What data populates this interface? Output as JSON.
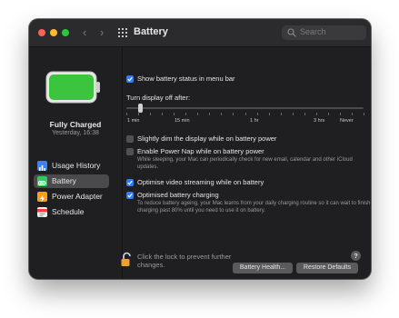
{
  "window": {
    "title": "Battery",
    "search_placeholder": "Search",
    "nav_back_glyph": "‹",
    "nav_forward_glyph": "›"
  },
  "colors": {
    "close": "#fe5f57",
    "minimize": "#febc2e",
    "zoom": "#28c840",
    "accent": "#2f7bf5",
    "battery_green": "#3cc43e"
  },
  "sidebar": {
    "battery_level_percent": 100,
    "status_title": "Fully Charged",
    "status_subtitle": "Yesterday, 16:38",
    "items": [
      {
        "label": "Usage History",
        "icon": "bar-chart-icon",
        "active": false
      },
      {
        "label": "Battery",
        "icon": "battery-icon",
        "active": true
      },
      {
        "label": "Power Adapter",
        "icon": "lightning-icon",
        "active": false
      },
      {
        "label": "Schedule",
        "icon": "calendar-icon",
        "active": false
      }
    ]
  },
  "main": {
    "show_in_menu_bar": {
      "label": "Show battery status in menu bar",
      "checked": true
    },
    "turn_display_off": {
      "label": "Turn display off after:",
      "value": "1 min",
      "ticks": [
        "1 min",
        "15 min",
        "1 hr",
        "3 hrs",
        "Never"
      ]
    },
    "dim_display": {
      "label": "Slightly dim the display while on battery power",
      "checked": false
    },
    "power_nap": {
      "label": "Enable Power Nap while on battery power",
      "checked": false,
      "description": "While sleeping, your Mac can periodically check for new email, calendar and other iCloud updates."
    },
    "optimise_video": {
      "label": "Optimise video streaming while on battery",
      "checked": true
    },
    "optimised_charging": {
      "label": "Optimised battery charging",
      "checked": true,
      "description": "To reduce battery ageing, your Mac learns from your daily charging routine so it can wait to finish charging past 80% until you need to use it on battery."
    }
  },
  "footer": {
    "lock_text": "Click the lock to prevent further changes.",
    "battery_health_button": "Battery Health...",
    "restore_defaults_button": "Restore Defaults",
    "help_label": "?"
  }
}
